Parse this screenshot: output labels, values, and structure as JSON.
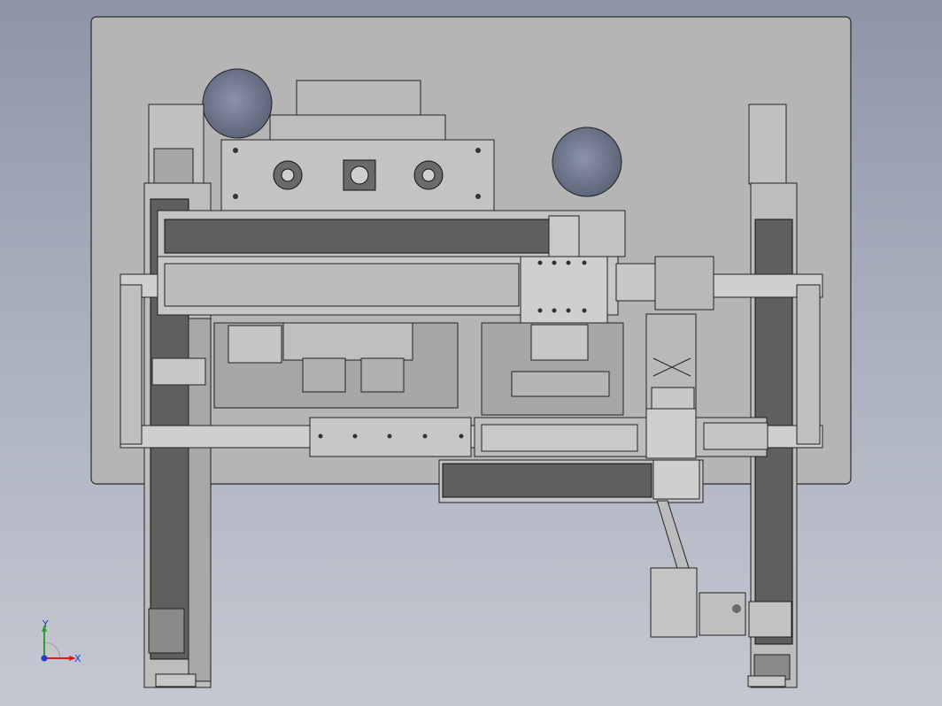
{
  "viewport": {
    "background_top": "#8e95a6",
    "background_bottom": "#c4c8d2",
    "plate_color": "#b5b5b5",
    "edge_color": "#2a2a2a",
    "rail_color": "#cfcfcf",
    "belt_color": "#5f5f5f"
  },
  "triad": {
    "x_label": "X",
    "y_label": "Y",
    "x_color": "#d0201f",
    "y_color": "#2ca02c",
    "z_color": "#1f3bd0"
  }
}
